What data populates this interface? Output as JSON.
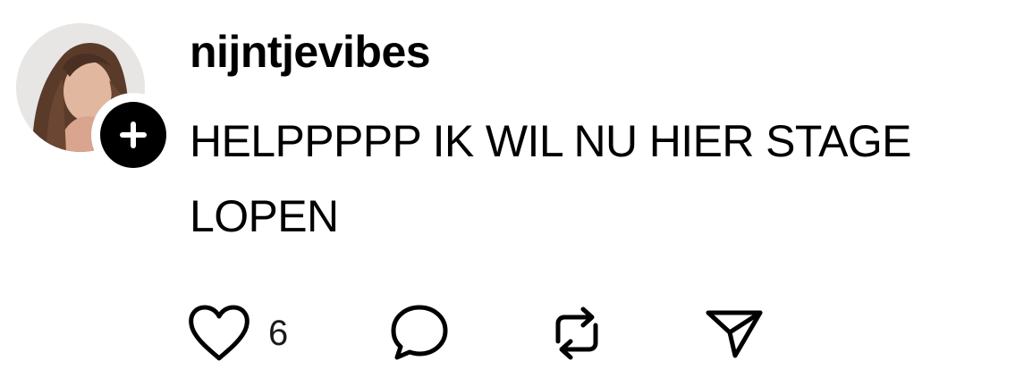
{
  "post": {
    "username": "nijntjevibes",
    "text": "HELPPPPP IK WIL NU HIER STAGE LOPEN"
  },
  "actions": {
    "like_count": "6"
  },
  "icons": {
    "avatar": "profile-photo",
    "follow": "plus-icon",
    "like": "heart-icon",
    "comment": "speech-bubble-icon",
    "repost": "repost-icon",
    "share": "send-icon"
  },
  "colors": {
    "text": "#000000",
    "icon": "#000000",
    "follow_badge": "#000000",
    "background": "#ffffff"
  }
}
